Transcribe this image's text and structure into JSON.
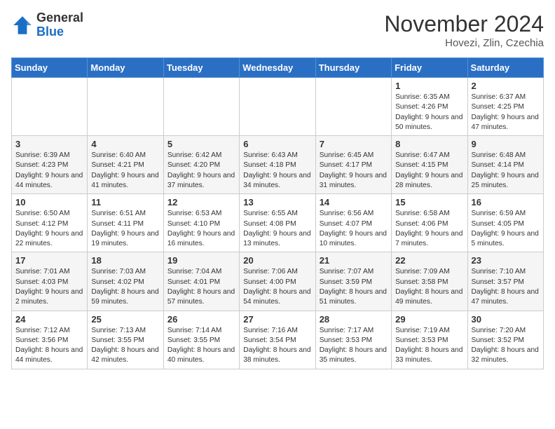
{
  "logo": {
    "general": "General",
    "blue": "Blue"
  },
  "title": "November 2024",
  "subtitle": "Hovezi, Zlin, Czechia",
  "days": [
    "Sunday",
    "Monday",
    "Tuesday",
    "Wednesday",
    "Thursday",
    "Friday",
    "Saturday"
  ],
  "weeks": [
    [
      {
        "day": "",
        "content": ""
      },
      {
        "day": "",
        "content": ""
      },
      {
        "day": "",
        "content": ""
      },
      {
        "day": "",
        "content": ""
      },
      {
        "day": "",
        "content": ""
      },
      {
        "day": "1",
        "content": "Sunrise: 6:35 AM\nSunset: 4:26 PM\nDaylight: 9 hours and 50 minutes."
      },
      {
        "day": "2",
        "content": "Sunrise: 6:37 AM\nSunset: 4:25 PM\nDaylight: 9 hours and 47 minutes."
      }
    ],
    [
      {
        "day": "3",
        "content": "Sunrise: 6:39 AM\nSunset: 4:23 PM\nDaylight: 9 hours and 44 minutes."
      },
      {
        "day": "4",
        "content": "Sunrise: 6:40 AM\nSunset: 4:21 PM\nDaylight: 9 hours and 41 minutes."
      },
      {
        "day": "5",
        "content": "Sunrise: 6:42 AM\nSunset: 4:20 PM\nDaylight: 9 hours and 37 minutes."
      },
      {
        "day": "6",
        "content": "Sunrise: 6:43 AM\nSunset: 4:18 PM\nDaylight: 9 hours and 34 minutes."
      },
      {
        "day": "7",
        "content": "Sunrise: 6:45 AM\nSunset: 4:17 PM\nDaylight: 9 hours and 31 minutes."
      },
      {
        "day": "8",
        "content": "Sunrise: 6:47 AM\nSunset: 4:15 PM\nDaylight: 9 hours and 28 minutes."
      },
      {
        "day": "9",
        "content": "Sunrise: 6:48 AM\nSunset: 4:14 PM\nDaylight: 9 hours and 25 minutes."
      }
    ],
    [
      {
        "day": "10",
        "content": "Sunrise: 6:50 AM\nSunset: 4:12 PM\nDaylight: 9 hours and 22 minutes."
      },
      {
        "day": "11",
        "content": "Sunrise: 6:51 AM\nSunset: 4:11 PM\nDaylight: 9 hours and 19 minutes."
      },
      {
        "day": "12",
        "content": "Sunrise: 6:53 AM\nSunset: 4:10 PM\nDaylight: 9 hours and 16 minutes."
      },
      {
        "day": "13",
        "content": "Sunrise: 6:55 AM\nSunset: 4:08 PM\nDaylight: 9 hours and 13 minutes."
      },
      {
        "day": "14",
        "content": "Sunrise: 6:56 AM\nSunset: 4:07 PM\nDaylight: 9 hours and 10 minutes."
      },
      {
        "day": "15",
        "content": "Sunrise: 6:58 AM\nSunset: 4:06 PM\nDaylight: 9 hours and 7 minutes."
      },
      {
        "day": "16",
        "content": "Sunrise: 6:59 AM\nSunset: 4:05 PM\nDaylight: 9 hours and 5 minutes."
      }
    ],
    [
      {
        "day": "17",
        "content": "Sunrise: 7:01 AM\nSunset: 4:03 PM\nDaylight: 9 hours and 2 minutes."
      },
      {
        "day": "18",
        "content": "Sunrise: 7:03 AM\nSunset: 4:02 PM\nDaylight: 8 hours and 59 minutes."
      },
      {
        "day": "19",
        "content": "Sunrise: 7:04 AM\nSunset: 4:01 PM\nDaylight: 8 hours and 57 minutes."
      },
      {
        "day": "20",
        "content": "Sunrise: 7:06 AM\nSunset: 4:00 PM\nDaylight: 8 hours and 54 minutes."
      },
      {
        "day": "21",
        "content": "Sunrise: 7:07 AM\nSunset: 3:59 PM\nDaylight: 8 hours and 51 minutes."
      },
      {
        "day": "22",
        "content": "Sunrise: 7:09 AM\nSunset: 3:58 PM\nDaylight: 8 hours and 49 minutes."
      },
      {
        "day": "23",
        "content": "Sunrise: 7:10 AM\nSunset: 3:57 PM\nDaylight: 8 hours and 47 minutes."
      }
    ],
    [
      {
        "day": "24",
        "content": "Sunrise: 7:12 AM\nSunset: 3:56 PM\nDaylight: 8 hours and 44 minutes."
      },
      {
        "day": "25",
        "content": "Sunrise: 7:13 AM\nSunset: 3:55 PM\nDaylight: 8 hours and 42 minutes."
      },
      {
        "day": "26",
        "content": "Sunrise: 7:14 AM\nSunset: 3:55 PM\nDaylight: 8 hours and 40 minutes."
      },
      {
        "day": "27",
        "content": "Sunrise: 7:16 AM\nSunset: 3:54 PM\nDaylight: 8 hours and 38 minutes."
      },
      {
        "day": "28",
        "content": "Sunrise: 7:17 AM\nSunset: 3:53 PM\nDaylight: 8 hours and 35 minutes."
      },
      {
        "day": "29",
        "content": "Sunrise: 7:19 AM\nSunset: 3:53 PM\nDaylight: 8 hours and 33 minutes."
      },
      {
        "day": "30",
        "content": "Sunrise: 7:20 AM\nSunset: 3:52 PM\nDaylight: 8 hours and 32 minutes."
      }
    ]
  ]
}
